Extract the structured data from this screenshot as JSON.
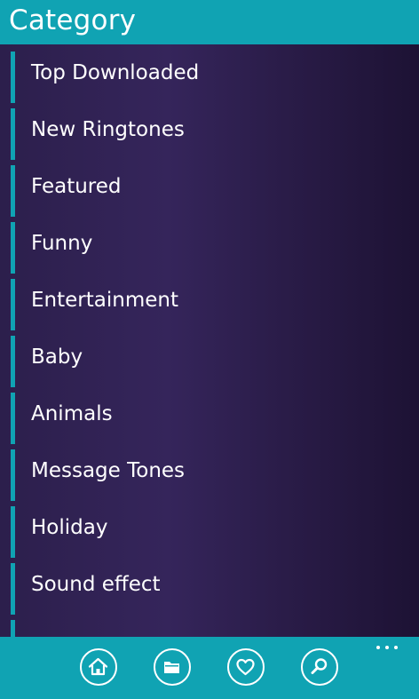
{
  "header": {
    "title": "Category"
  },
  "categories": [
    {
      "label": "Top Downloaded"
    },
    {
      "label": "New Ringtones"
    },
    {
      "label": "Featured"
    },
    {
      "label": "Funny"
    },
    {
      "label": "Entertainment"
    },
    {
      "label": "Baby"
    },
    {
      "label": "Animals"
    },
    {
      "label": "Message Tones"
    },
    {
      "label": "Holiday"
    },
    {
      "label": "Sound effect"
    },
    {
      "label": ""
    }
  ],
  "appbar": {
    "buttons": [
      {
        "icon": "home-icon"
      },
      {
        "icon": "folder-icon"
      },
      {
        "icon": "heart-icon"
      },
      {
        "icon": "search-icon"
      }
    ],
    "more_icon": "more-icon"
  },
  "colors": {
    "accent": "#10a3b3",
    "background": "#2e1f4f",
    "text": "#ffffff"
  }
}
